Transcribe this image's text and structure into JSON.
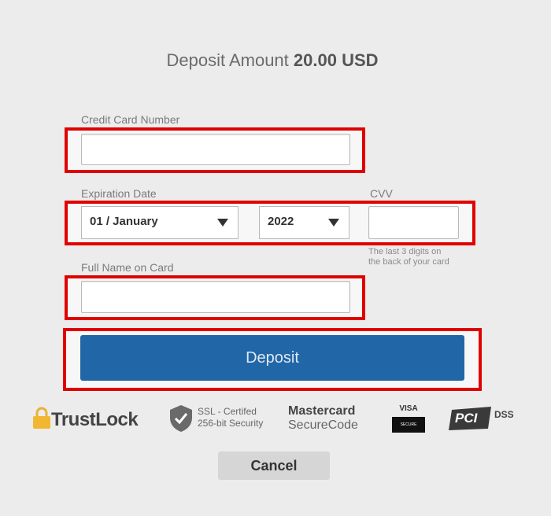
{
  "header": {
    "title_prefix": "Deposit Amount",
    "title_amount": "20.00 USD"
  },
  "form": {
    "card_number_label": "Credit Card Number",
    "card_number_value": "",
    "expiration_label": "Expiration Date",
    "month_value": "01 / January",
    "year_value": "2022",
    "cvv_label": "CVV",
    "cvv_value": "",
    "cvv_hint_line1": "The last 3 digits on",
    "cvv_hint_line2": "the back of your card",
    "name_label": "Full Name on Card",
    "name_value": ""
  },
  "actions": {
    "deposit_label": "Deposit",
    "cancel_label": "Cancel"
  },
  "badges": {
    "trustlock_prefix": "Trust",
    "trustlock_suffix": "Lock",
    "ssl_line1": "SSL - Certifed",
    "ssl_line2": "256-bit Security",
    "mastercard_line1": "Mastercard",
    "mastercard_line2": "SecureCode",
    "visa_line": "VISA",
    "visa_sub": "SECURE",
    "pci_main": "PCI",
    "pci_dss": "DSS"
  },
  "colors": {
    "highlight": "#e00000",
    "deposit_button": "#2166a7",
    "background": "#ececec"
  }
}
